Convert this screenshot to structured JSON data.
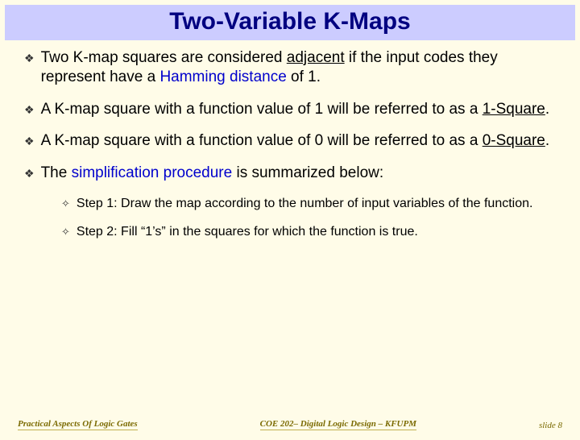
{
  "title": "Two-Variable K-Maps",
  "bullets": [
    {
      "pre": "Two K-map squares are considered ",
      "u1": "adjacent",
      "mid": " if the input codes they represent have a ",
      "blue": "Hamming distance",
      "post": " of 1."
    },
    {
      "pre": "A K-map square with a function value of 1 will be referred to as a ",
      "u1": "1-Square",
      "post2": "."
    },
    {
      "pre": "A K-map square with a function value of 0 will be referred to as a ",
      "u1": "0-Square",
      "post2": "."
    },
    {
      "pre": "The ",
      "blue": "simplification procedure",
      "post": " is summarized below:"
    }
  ],
  "steps": [
    "Step 1: Draw the map according to the number of input variables of the function.",
    "Step 2: Fill “1’s” in the squares for which the function is true."
  ],
  "footer": {
    "left": "Practical Aspects Of Logic Gates",
    "center": "COE 202– Digital Logic Design – KFUPM",
    "right": "slide 8"
  }
}
